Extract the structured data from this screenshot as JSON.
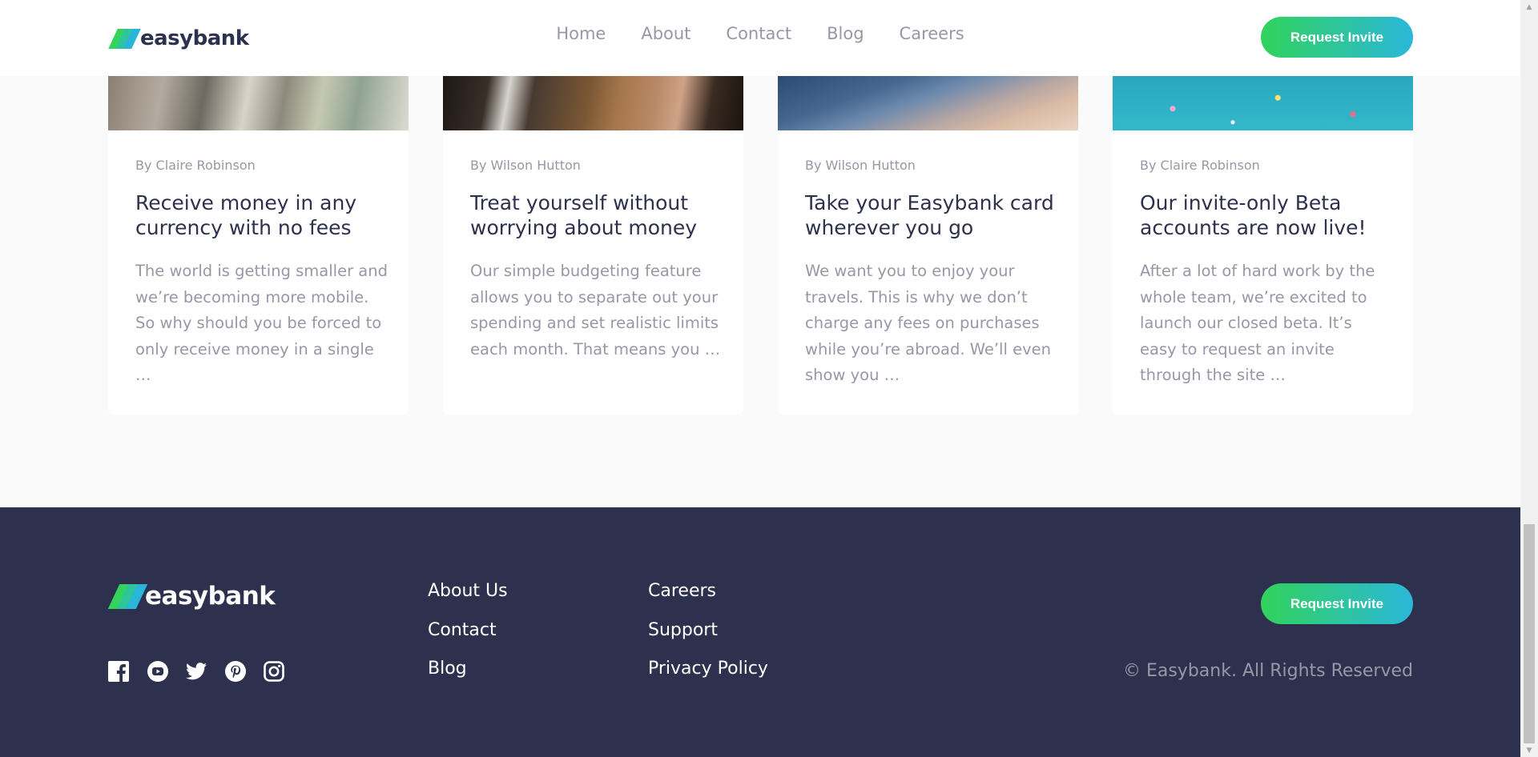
{
  "brand": {
    "name": "easybank",
    "logo_colors": [
      "#33d35e",
      "#2ab6d9"
    ]
  },
  "header": {
    "nav": [
      "Home",
      "About",
      "Contact",
      "Blog",
      "Careers"
    ],
    "cta_label": "Request Invite"
  },
  "articles": [
    {
      "author": "By Claire Robinson",
      "title": "Receive money in any currency with no fees",
      "excerpt": "The world is getting smaller and we’re becoming more mobile. So why should you be forced to only receive money in a single …",
      "image_icon": "currency-photo"
    },
    {
      "author": "By Wilson Hutton",
      "title": "Treat yourself without worrying about money",
      "excerpt": "Our simple budgeting feature allows you to separate out your spending and set realistic limits each month. That means you …",
      "image_icon": "restaurant-photo"
    },
    {
      "author": "By Wilson Hutton",
      "title": "Take your Easybank card wherever you go",
      "excerpt": "We want you to enjoy your travels. This is why we don’t charge any fees on purchases while you’re abroad. We’ll even show you …",
      "image_icon": "plane-photo"
    },
    {
      "author": "By Claire Robinson",
      "title": "Our invite-only Beta accounts are now live!",
      "excerpt": "After a lot of hard work by the whole team, we’re excited to launch our closed beta. It’s easy to request an invite through the site …",
      "image_icon": "confetti-photo"
    }
  ],
  "footer": {
    "links_col1": [
      "About Us",
      "Contact",
      "Blog"
    ],
    "links_col2": [
      "Careers",
      "Support",
      "Privacy Policy"
    ],
    "cta_label": "Request Invite",
    "copyright": "© Easybank. All Rights Reserved",
    "social_icons": [
      "facebook-icon",
      "youtube-icon",
      "twitter-icon",
      "pinterest-icon",
      "instagram-icon"
    ]
  },
  "colors": {
    "dark_blue": "#2d314d",
    "grayish_blue": "#9698a6",
    "lime_green": "#31d35c",
    "bright_cyan": "#2bb7da",
    "light_gray_bg": "#fafafa"
  }
}
